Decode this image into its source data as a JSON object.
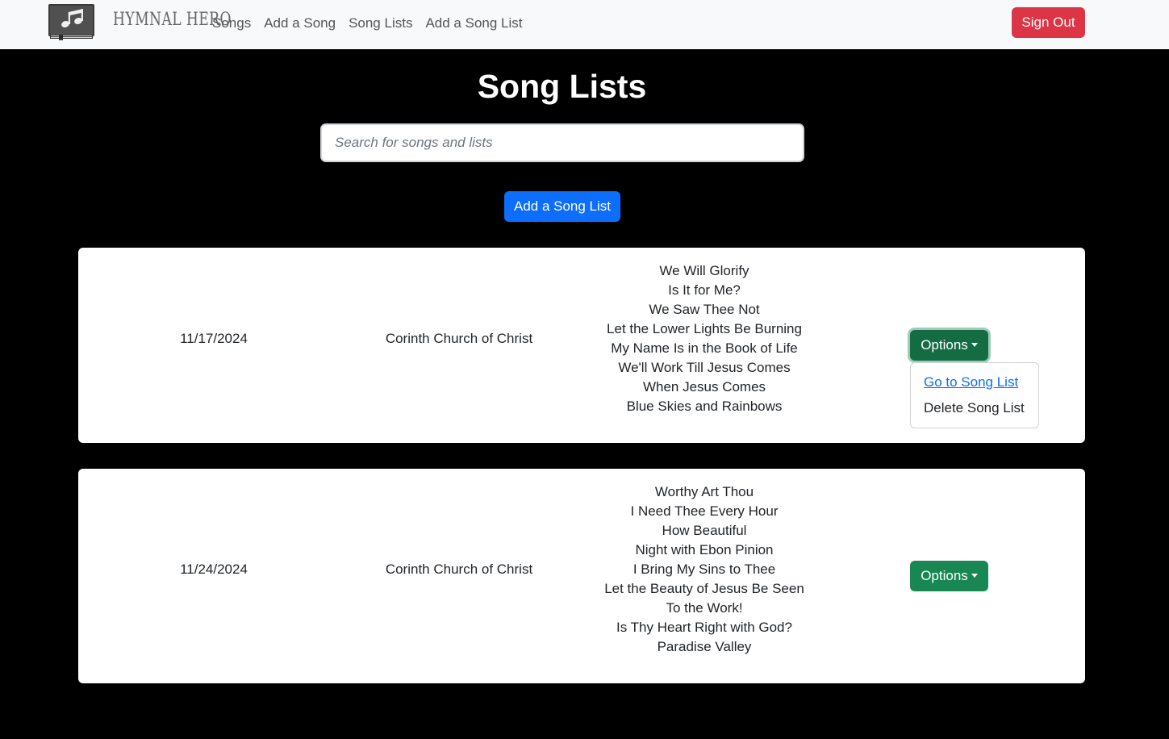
{
  "navbar": {
    "brand": "HYMNAL HERO",
    "links": [
      "Songs",
      "Add a Song",
      "Song Lists",
      "Add a Song List"
    ],
    "sign_out": "Sign Out"
  },
  "main": {
    "title": "Song Lists",
    "search_placeholder": "Search for songs and lists",
    "add_button": "Add a Song List"
  },
  "song_lists": [
    {
      "date": "11/17/2024",
      "church": "Corinth Church of Christ",
      "songs": [
        "We Will Glorify",
        "Is It for Me?",
        "We Saw Thee Not",
        "Let the Lower Lights Be Burning",
        "My Name Is in the Book of Life",
        "We'll Work Till Jesus Comes",
        "When Jesus Comes",
        "Blue Skies and Rainbows"
      ],
      "options_label": "Options"
    },
    {
      "date": "11/24/2024",
      "church": "Corinth Church of Christ",
      "songs": [
        "Worthy Art Thou",
        "I Need Thee Every Hour",
        "How Beautiful",
        "Night with Ebon Pinion",
        "I Bring My Sins to Thee",
        "Let the Beauty of Jesus Be Seen",
        "To the Work!",
        "Is Thy Heart Right with God?",
        "Paradise Valley"
      ],
      "options_label": "Options"
    }
  ],
  "dropdown": {
    "items": [
      "Go to Song List",
      "Delete Song List"
    ]
  },
  "colors": {
    "danger": "#dc3545",
    "primary": "#0d6efd",
    "success": "#198754",
    "background": "#000000"
  }
}
